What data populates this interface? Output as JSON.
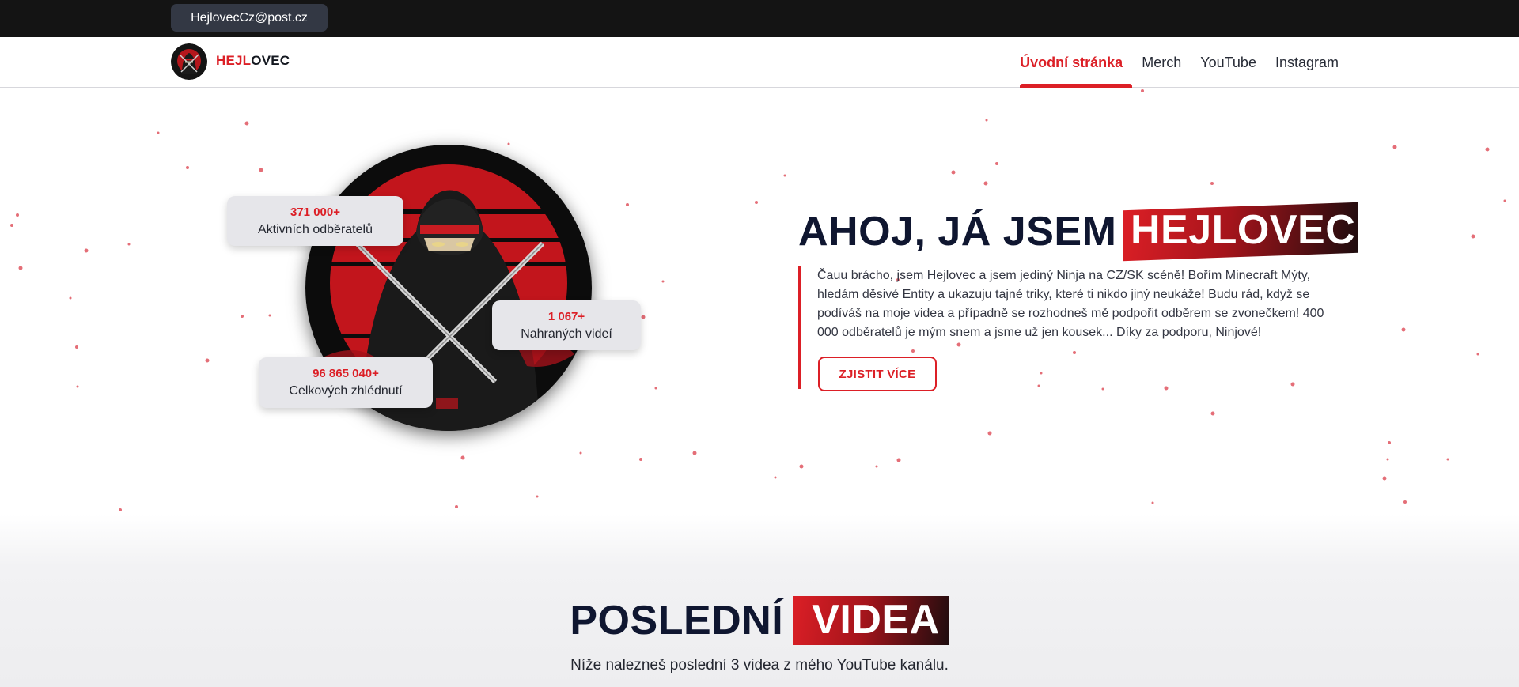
{
  "topbar": {
    "email": "HejlovecCz@post.cz"
  },
  "navbar": {
    "logo_part1": "HEJL",
    "logo_part2": "OVEC",
    "links": [
      {
        "label": "Úvodní stránka",
        "active": true
      },
      {
        "label": "Merch",
        "active": false
      },
      {
        "label": "YouTube",
        "active": false
      },
      {
        "label": "Instagram",
        "active": false
      }
    ]
  },
  "hero": {
    "title_prefix": "AHOJ, JÁ JSEM",
    "title_highlight": "HEJLOVEC",
    "text": "Čauu brácho, jsem Hejlovec a jsem jediný Ninja na CZ/SK scéně! Bořím Minecraft Mýty, hledám děsivé Entity a ukazuju tajné triky, které ti nikdo jiný neukáže! Budu rád, když se podíváš na moje videa a případně se rozhodneš mě podpořit odběrem se zvonečkem! 400 000 odběratelů je mým snem a jsme už jen kousek... Díky za podporu, Ninjové!",
    "cta_label": "ZJISTIT VÍCE",
    "stats": {
      "subscribers": {
        "value": "371 000+",
        "label": "Aktivních odběratelů"
      },
      "videos": {
        "value": "1 067+",
        "label": "Nahraných videí"
      },
      "views": {
        "value": "96 865 040+",
        "label": "Celkových zhlédnutí"
      }
    }
  },
  "latest": {
    "title_prefix": "POSLEDNÍ",
    "title_highlight": "VIDEA",
    "subtitle": "Níže nalezneš poslední 3 videa z mého YouTube kanálu."
  },
  "colors": {
    "accent": "#dc1f26",
    "dark": "#0f1630",
    "topbar": "#141414"
  }
}
